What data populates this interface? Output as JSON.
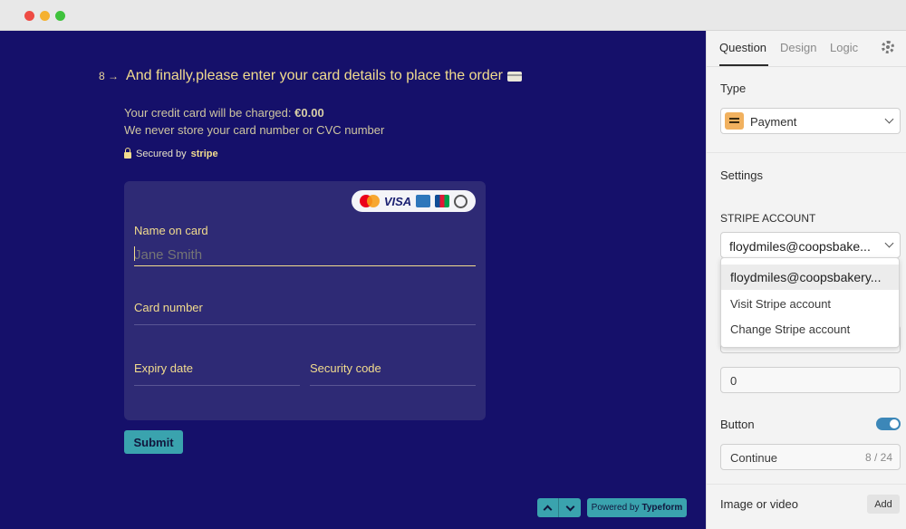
{
  "question": {
    "number": "8",
    "arrow": "→",
    "text": "And finally,please enter your card details to place the order",
    "charge_prefix": "Your credit card will be charged:",
    "charge_amount": "€0.00",
    "store_note": "We never store your card number or CVC number",
    "secured_by": "Secured by",
    "secured_brand": "stripe"
  },
  "card_form": {
    "brands": [
      "Mastercard",
      "VISA",
      "American Express",
      "JCB",
      "Diners Club"
    ],
    "visa_text": "VISA",
    "name_label": "Name on card",
    "name_placeholder": "Jane Smith",
    "card_number_label": "Card number",
    "expiry_label": "Expiry date",
    "security_label": "Security code",
    "submit_label": "Submit"
  },
  "footer": {
    "powered_prefix": "Powered by",
    "powered_brand": "Typeform"
  },
  "sidebar": {
    "tabs": [
      "Question",
      "Design",
      "Logic"
    ],
    "active_tab": "Question",
    "type_label": "Type",
    "type_value": "Payment",
    "settings_label": "Settings",
    "stripe_account_label": "STRIPE ACCOUNT",
    "stripe_account_value": "floydmiles@coopsbake...",
    "dropdown_items": [
      "floydmiles@coopsbakery...",
      "Visit Stripe account",
      "Change Stripe account"
    ],
    "amount_value": "0",
    "button_label": "Button",
    "button_toggle_on": true,
    "button_text_value": "Continue",
    "button_text_count": "8 / 24",
    "image_label": "Image or video",
    "add_label": "Add"
  },
  "colors": {
    "form_background": "#15106a",
    "accent_yellow": "#f2dc8e",
    "button_teal": "#3aa3ae",
    "toggle_blue": "#3c87b8"
  }
}
